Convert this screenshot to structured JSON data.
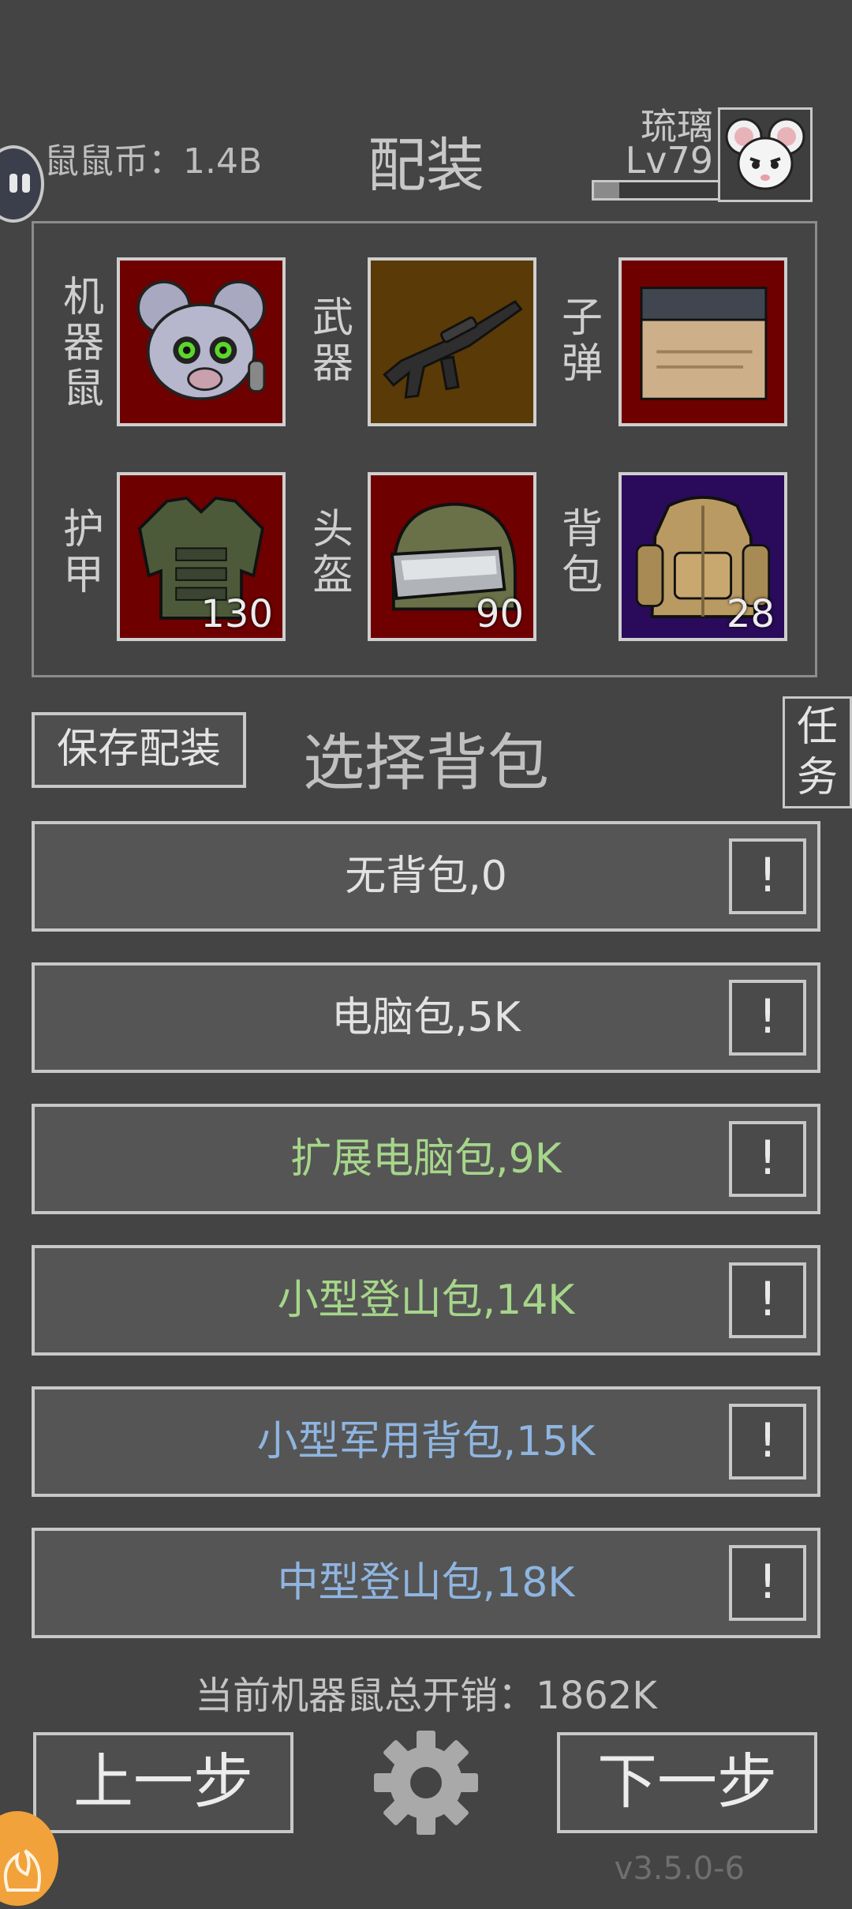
{
  "header": {
    "coins_label": "鼠鼠币：1.4B",
    "title": "配装",
    "username": "琉璃",
    "level": "Lv79",
    "xp_fraction": 0.2
  },
  "loadout": {
    "slots": [
      {
        "label": "机器鼠",
        "icon": "robot-mouse-icon",
        "bg": "#6e0000"
      },
      {
        "label": "武器",
        "icon": "rifle-icon",
        "bg": "#5a3a06"
      },
      {
        "label": "子弹",
        "icon": "ammo-box-icon",
        "bg": "#6e0000"
      },
      {
        "label": "护甲",
        "icon": "armor-vest-icon",
        "bg": "#6e0000",
        "count": "130"
      },
      {
        "label": "头盔",
        "icon": "helmet-icon",
        "bg": "#6e0000",
        "count": "90"
      },
      {
        "label": "背包",
        "icon": "backpack-icon",
        "bg": "#2a0a5a",
        "count": "28"
      }
    ]
  },
  "actions": {
    "save_label": "保存配装",
    "section_title": "选择背包",
    "task_label": "任务"
  },
  "options": [
    {
      "label": "无背包,0",
      "color": "#e2e2e2",
      "info": "!"
    },
    {
      "label": "电脑包,5K",
      "color": "#e2e2e2",
      "info": "!"
    },
    {
      "label": "扩展电脑包,9K",
      "color": "#a6d68a",
      "info": "!"
    },
    {
      "label": "小型登山包,14K",
      "color": "#a6d68a",
      "info": "!"
    },
    {
      "label": "小型军用背包,15K",
      "color": "#8fb5e0",
      "info": "!"
    },
    {
      "label": "中型登山包,18K",
      "color": "#8fb5e0",
      "info": "!"
    }
  ],
  "footer": {
    "total_label": "当前机器鼠总开销：1862K",
    "prev_label": "上一步",
    "next_label": "下一步",
    "version": "v3.5.0-6"
  }
}
